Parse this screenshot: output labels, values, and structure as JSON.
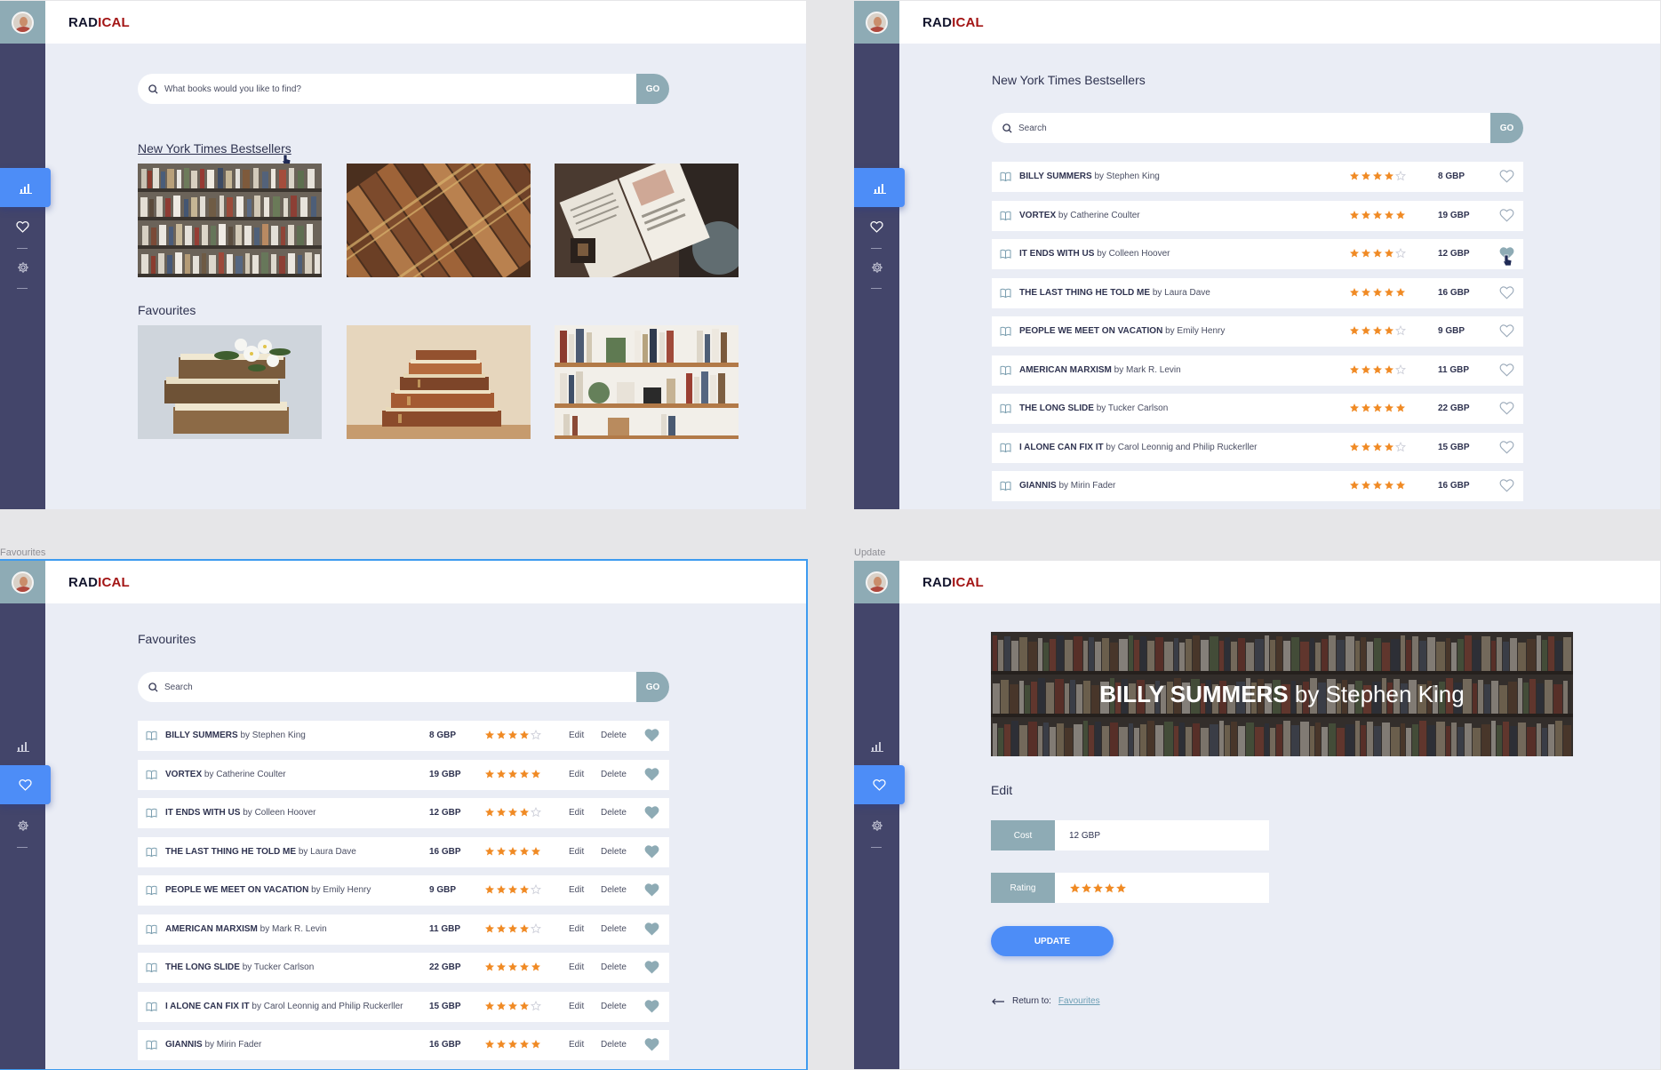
{
  "app": {
    "logo_part1": "RAD",
    "logo_part2": "ICAL"
  },
  "frame_labels": {
    "favourites": "Favourites",
    "update": "Update"
  },
  "colors": {
    "sidebar": "#43456a",
    "accent": "#4d8df7",
    "teal": "#8eabb5",
    "star": "#f08a24",
    "brand_red": "#a31515"
  },
  "home": {
    "search_placeholder": "What books would you like to find?",
    "go_label": "GO",
    "bestsellers_heading": "New York Times Bestsellers",
    "favourites_heading": "Favourites"
  },
  "bestsellers": {
    "heading": "New York Times Bestsellers",
    "search_placeholder": "Search",
    "go_label": "GO",
    "books": [
      {
        "title": "BILLY SUMMERS",
        "author": "by Stephen King",
        "rating": 4,
        "price": "8 GBP"
      },
      {
        "title": "VORTEX",
        "author": "by Catherine Coulter",
        "rating": 5,
        "price": "19 GBP"
      },
      {
        "title": "IT ENDS WITH US",
        "author": "by Colleen Hoover",
        "rating": 4,
        "price": "12 GBP"
      },
      {
        "title": "THE LAST THING HE TOLD ME",
        "author": "by Laura Dave",
        "rating": 5,
        "price": "16 GBP"
      },
      {
        "title": "PEOPLE WE MEET ON VACATION",
        "author": "by Emily Henry",
        "rating": 4,
        "price": "9 GBP"
      },
      {
        "title": "AMERICAN MARXISM",
        "author": "by Mark R. Levin",
        "rating": 4,
        "price": "11 GBP"
      },
      {
        "title": "THE LONG SLIDE",
        "author": "by Tucker Carlson",
        "rating": 5,
        "price": "22 GBP"
      },
      {
        "title": "I ALONE CAN FIX IT",
        "author": "by Carol Leonnig and Philip Ruckerller",
        "rating": 4,
        "price": "15 GBP"
      },
      {
        "title": "GIANNIS",
        "author": "by Mirin Fader",
        "rating": 5,
        "price": "16 GBP"
      }
    ]
  },
  "favourites": {
    "heading": "Favourites",
    "search_placeholder": "Search",
    "go_label": "GO",
    "edit_label": "Edit",
    "delete_label": "Delete"
  },
  "update": {
    "banner_title": "BILLY SUMMERS",
    "banner_author": "by Stephen King",
    "edit_heading": "Edit",
    "cost_label": "Cost",
    "cost_value": "12 GBP",
    "rating_label": "Rating",
    "rating_value": 5,
    "update_button": "UPDATE",
    "return_label": "Return to:",
    "return_link": "Favourites"
  }
}
